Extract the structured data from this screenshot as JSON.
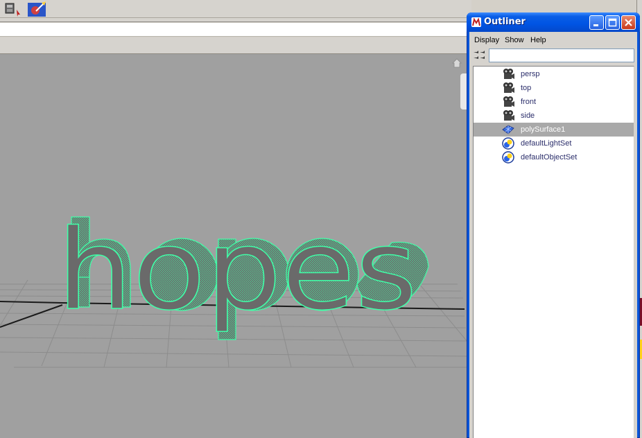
{
  "colors": {
    "viewport_bg": "#a0a0a0",
    "selection_wire": "#40ffa8",
    "title_bar": "#0054e3",
    "selected_row": "#a9a9a9"
  },
  "viewport": {
    "text_object": "hopes"
  },
  "outliner": {
    "title": "Outliner",
    "menu": [
      "Display",
      "Show",
      "Help"
    ],
    "filter_value": "",
    "items": [
      {
        "label": "persp",
        "icon": "camera-icon",
        "selected": false
      },
      {
        "label": "top",
        "icon": "camera-icon",
        "selected": false
      },
      {
        "label": "front",
        "icon": "camera-icon",
        "selected": false
      },
      {
        "label": "side",
        "icon": "camera-icon",
        "selected": false
      },
      {
        "label": "polySurface1",
        "icon": "poly-mesh-icon",
        "selected": true
      },
      {
        "label": "defaultLightSet",
        "icon": "set-icon",
        "selected": false
      },
      {
        "label": "defaultObjectSet",
        "icon": "set-icon",
        "selected": false
      }
    ]
  }
}
